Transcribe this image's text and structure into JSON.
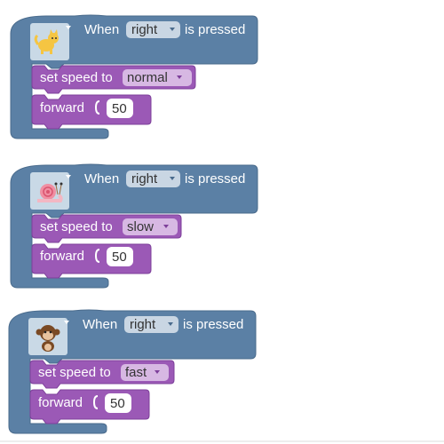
{
  "colors": {
    "event_block": "#5b80a5",
    "event_block_dark": "#4a6b8c",
    "action_block": "#9b59b6",
    "action_block_dark": "#7d3f9a",
    "dropdown_bg_event": "#c9d6e3",
    "dropdown_bg_action": "#d7b8e3",
    "value_bubble": "#ffffff",
    "sprite_tile": "#c9d9e6"
  },
  "blocks": [
    {
      "sprite_icon": "cat-sprite-icon",
      "event_prefix": "When",
      "key": "right",
      "event_suffix": "is pressed",
      "speed_prefix": "set speed to",
      "speed_value": "normal",
      "forward_label": "forward",
      "forward_value": "50"
    },
    {
      "sprite_icon": "snail-sprite-icon",
      "event_prefix": "When",
      "key": "right",
      "event_suffix": "is pressed",
      "speed_prefix": "set speed to",
      "speed_value": "slow",
      "forward_label": "forward",
      "forward_value": "50"
    },
    {
      "sprite_icon": "monkey-sprite-icon",
      "event_prefix": "When",
      "key": "right",
      "event_suffix": "is pressed",
      "speed_prefix": "set speed to",
      "speed_value": "fast",
      "forward_label": "forward",
      "forward_value": "50"
    }
  ]
}
